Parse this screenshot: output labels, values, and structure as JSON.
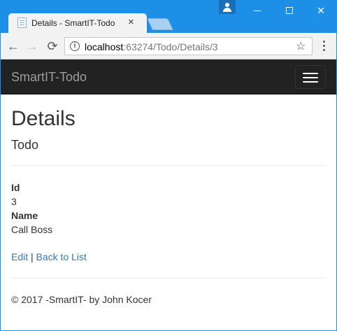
{
  "browser": {
    "tab_title": "Details - SmartIT-Todo",
    "tab_close": "×",
    "url_host": "localhost",
    "url_rest": ":63274/Todo/Details/3",
    "window_controls": {
      "minimize": "minimize",
      "maximize": "maximize",
      "close": "✕"
    },
    "nav": {
      "back": "←",
      "forward": "→",
      "reload": "⟳"
    },
    "star": "☆",
    "info": "i"
  },
  "navbar": {
    "brand": "SmartIT-Todo"
  },
  "main": {
    "title": "Details",
    "subtitle": "Todo",
    "fields": [
      {
        "label": "Id",
        "value": "3"
      },
      {
        "label": "Name",
        "value": "Call Boss"
      }
    ],
    "edit_link": "Edit",
    "separator": "|",
    "back_link": "Back to List"
  },
  "footer": {
    "text": "© 2017 -SmartIT- by John Kocer"
  },
  "colors": {
    "titlebar": "#1e8fe6",
    "navbar": "#222222",
    "link": "#337ab7"
  }
}
